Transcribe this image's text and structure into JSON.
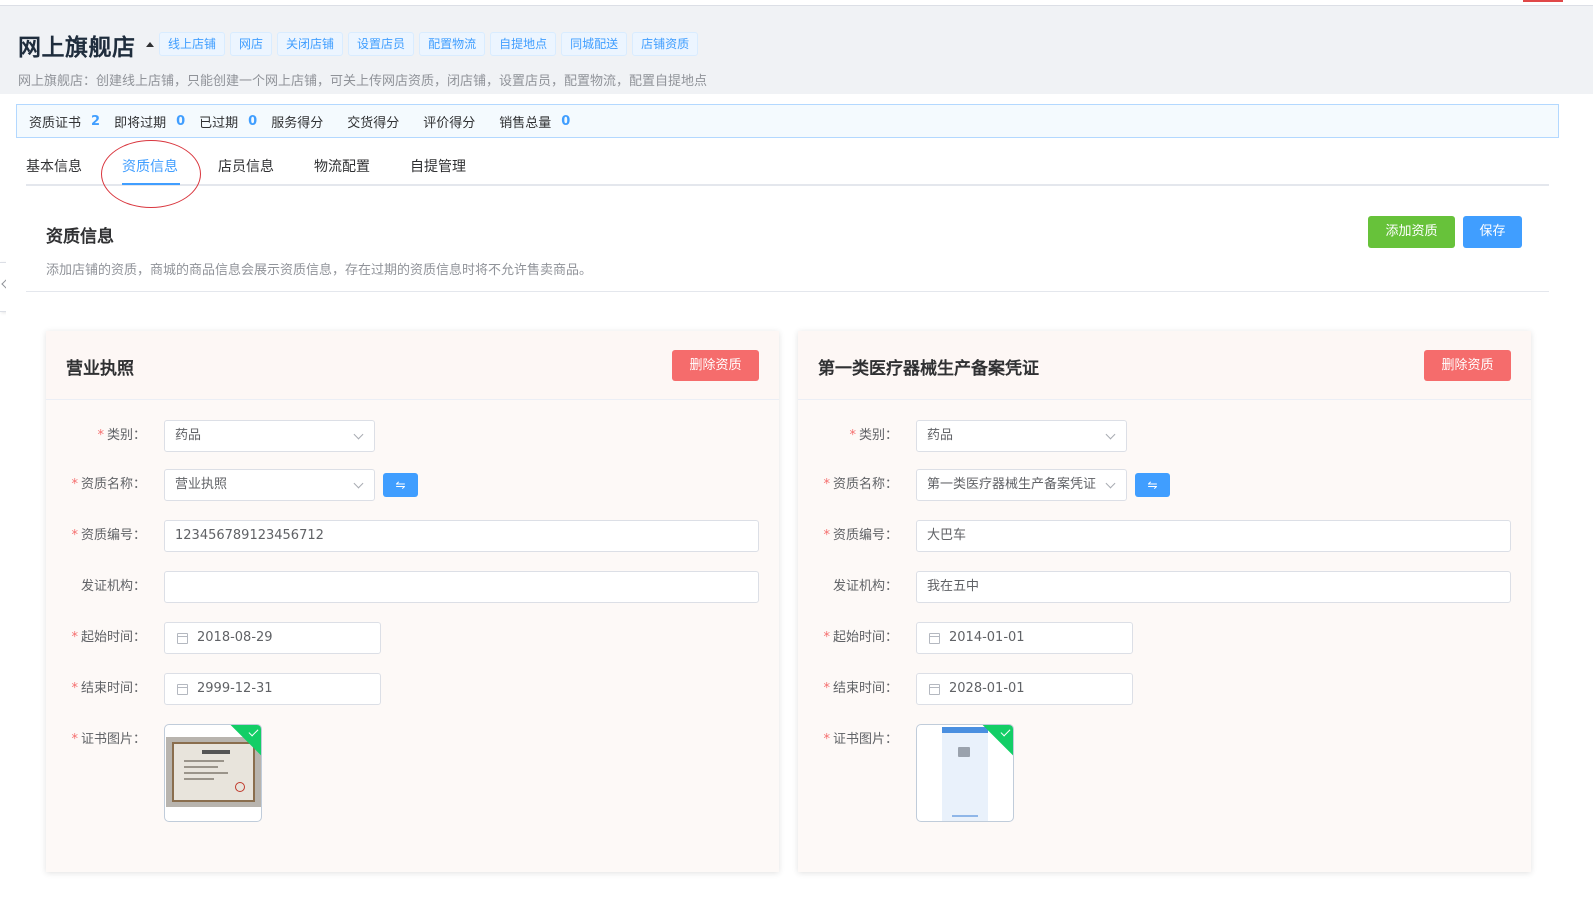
{
  "header": {
    "title": "网上旗舰店",
    "tags": [
      "线上店铺",
      "网店",
      "关闭店铺",
      "设置店员",
      "配置物流",
      "自提地点",
      "同城配送",
      "店铺资质"
    ],
    "description": "网上旗舰店：创建线上店铺，只能创建一个网上店铺，可关上传网店资质，闭店铺，设置店员，配置物流，配置自提地点"
  },
  "stats": {
    "cert_label": "资质证书",
    "cert_value": "2",
    "expiring_label": "即将过期",
    "expiring_value": "0",
    "expired_label": "已过期",
    "expired_value": "0",
    "service_label": "服务得分",
    "delivery_label": "交货得分",
    "review_label": "评价得分",
    "sales_label": "销售总量",
    "sales_value": "0"
  },
  "tabs": {
    "basic": "基本信息",
    "qualification": "资质信息",
    "staff": "店员信息",
    "logistics": "物流配置",
    "pickup": "自提管理"
  },
  "section": {
    "title": "资质信息",
    "description": "添加店铺的资质，商城的商品信息会展示资质信息，存在过期的资质信息时将不允许售卖商品。",
    "add_label": "添加资质",
    "save_label": "保存"
  },
  "form_labels": {
    "category": "类别：",
    "name": "资质名称：",
    "number": "资质编号：",
    "issuer": "发证机构：",
    "start": "起始时间：",
    "end": "结束时间：",
    "image": "证书图片："
  },
  "cards": [
    {
      "title": "营业执照",
      "delete_label": "删除资质",
      "category": "药品",
      "name": "营业执照",
      "number": "123456789123456712",
      "issuer": "",
      "start_date": "2018-08-29",
      "end_date": "2999-12-31",
      "image_icon": "certificate-thumbnail"
    },
    {
      "title": "第一类医疗器械生产备案凭证",
      "delete_label": "删除资质",
      "category": "药品",
      "name": "第一类医疗器械生产备案凭证",
      "number": "大巴车",
      "issuer": "我在五中",
      "start_date": "2014-01-01",
      "end_date": "2028-01-01",
      "image_icon": "phone-screenshot-thumbnail"
    }
  ],
  "swap_icon": "⇋",
  "colors": {
    "primary": "#409eff",
    "success": "#67c23a",
    "danger": "#f56c6c",
    "upload_ok": "#13ce66"
  }
}
